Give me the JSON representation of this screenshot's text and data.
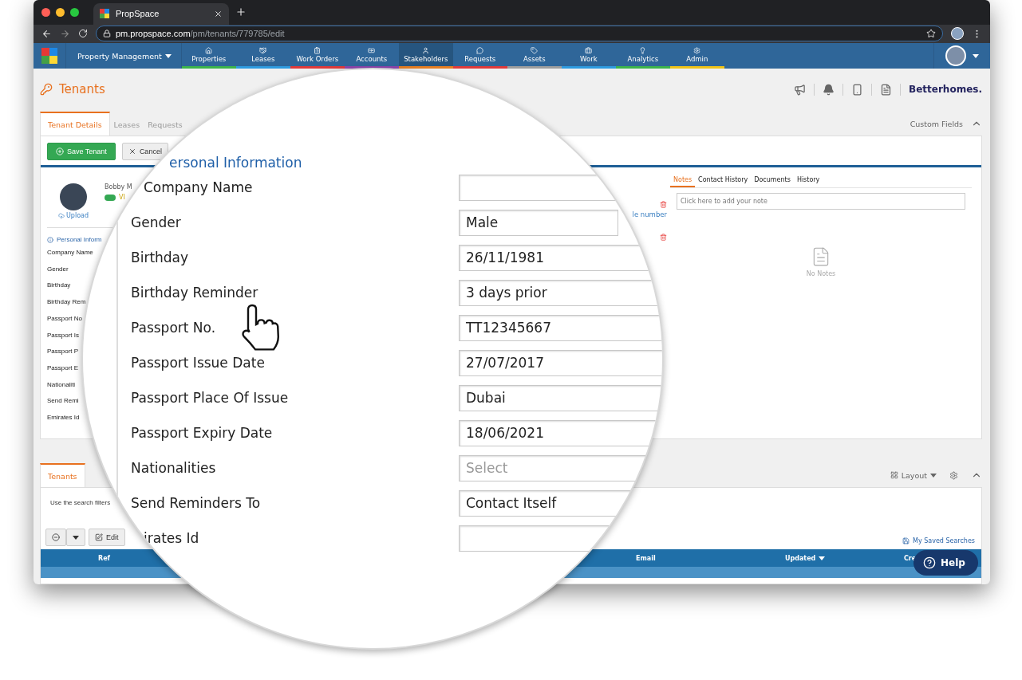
{
  "browser": {
    "tab_title": "PropSpace",
    "url": "**pm.propspace.com**/pm/tenants/779785/edit"
  },
  "navbar": {
    "module": "Property Management",
    "items": [
      {
        "label": "Properties",
        "color": "#3cb44b",
        "selected": false
      },
      {
        "label": "Leases",
        "color": "#2e9be0",
        "selected": false
      },
      {
        "label": "Work Orders",
        "color": "#e03a3a",
        "selected": false
      },
      {
        "label": "Accounts",
        "color": "#8e44ad",
        "selected": false
      },
      {
        "label": "Stakeholders",
        "color": "#e67e22",
        "selected": true
      },
      {
        "label": "Requests",
        "color": "#e03a3a",
        "selected": false
      },
      {
        "label": "Assets",
        "color": "#9e9e9e",
        "selected": false
      },
      {
        "label": "Work",
        "color": "#2e9be0",
        "selected": false
      },
      {
        "label": "Analytics",
        "color": "#3cb44b",
        "selected": false
      },
      {
        "label": "Admin",
        "color": "#f0c419",
        "selected": false
      }
    ]
  },
  "page": {
    "title": "Tenants",
    "brand": "Betterhomes."
  },
  "detail_tabs": [
    {
      "label": "Tenant Details",
      "selected": true
    },
    {
      "label": "Leases",
      "selected": false
    },
    {
      "label": "Requests",
      "selected": false
    }
  ],
  "custom_fields": "Custom Fields",
  "actions": {
    "save": "Save Tenant",
    "cancel": "Cancel"
  },
  "profile": {
    "name": "Bobby M",
    "upload": "Upload",
    "status": "VI",
    "active": true
  },
  "section_title": "Personal Inform",
  "field_labels": [
    "Company Name",
    "Gender",
    "Birthday",
    "Birthday Rem",
    "Passport No",
    "Passport Is",
    "Passport P",
    "Passport E",
    "Nationaliti",
    "Send Remi",
    "Emirates Id"
  ],
  "phone_link": "le number",
  "notes": {
    "tabs": [
      {
        "label": "Notes",
        "selected": true
      },
      {
        "label": "Contact History",
        "selected": false
      },
      {
        "label": "Documents",
        "selected": false
      },
      {
        "label": "History",
        "selected": false
      }
    ],
    "placeholder": "Click here to add your note",
    "empty": "No Notes"
  },
  "list": {
    "tabs": [
      {
        "label": "Tenants",
        "selected": true
      }
    ],
    "layout": "Layout",
    "hint": "Use the search filters",
    "edit": "Edit",
    "saved_searches": "My Saved Searches",
    "columns": [
      {
        "label": "Ref",
        "sorted": false
      },
      {
        "label": "Email",
        "sorted": false
      },
      {
        "label": "Updated",
        "sorted": true
      },
      {
        "label": "Cre",
        "sorted": false
      }
    ]
  },
  "help": "Help",
  "magnifier": {
    "heading": "ersonal Information",
    "fields": [
      {
        "label": "Company Name"
      },
      {
        "label": "Gender",
        "value": "Male"
      },
      {
        "label": "Birthday",
        "value": "26/11/1981"
      },
      {
        "label": "Birthday Reminder",
        "value": "3 days prior"
      },
      {
        "label": "Passport No.",
        "value": "TT12345667"
      },
      {
        "label": "Passport Issue Date",
        "value": "27/07/2017"
      },
      {
        "label": "Passport Place Of Issue",
        "value": "Dubai"
      },
      {
        "label": "Passport Expiry Date",
        "value": "18/06/2021"
      },
      {
        "label": "Nationalities",
        "placeholder": "Select"
      },
      {
        "label": "Send Reminders To",
        "value": "Contact Itself"
      },
      {
        "label": "irates Id"
      }
    ]
  }
}
